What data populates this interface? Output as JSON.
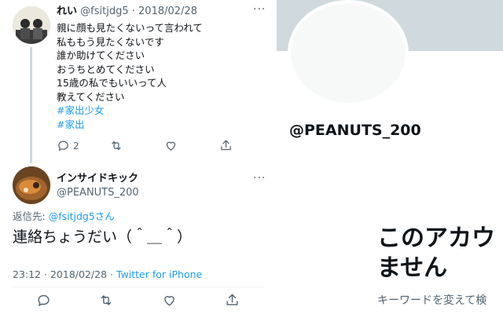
{
  "tweet1": {
    "display_name": "れい",
    "handle": "@fsitjdg5",
    "separator": "·",
    "date": "2018/02/28",
    "more": "···",
    "lines": [
      "親に顔も見たくないって言われて",
      "私ももう見たくないです",
      "誰か助けてください",
      "おうちとめてください",
      "15歳の私でもいいって人",
      "教えてください"
    ],
    "hashtags": [
      "#家出少女",
      "#家出"
    ],
    "reply_count": "2"
  },
  "tweet2": {
    "display_name": "インサイドキック",
    "handle": "@PEANUTS_200",
    "more": "···",
    "reply_to_label": "返信先:",
    "reply_to_user": "@fsitjdg5さん",
    "text": "連絡ちょうだい（＾＿＾）",
    "time": "23:12",
    "separator": "·",
    "date": "2018/02/28",
    "source": "Twitter for iPhone"
  },
  "profile": {
    "handle": "@PEANUTS_200",
    "not_exist_line1": "このアカウ",
    "not_exist_line2": "ません",
    "hint": "キーワードを変えて検"
  },
  "colors": {
    "link": "#1d9bf0",
    "muted": "#536471",
    "banner": "#cfd9de"
  }
}
